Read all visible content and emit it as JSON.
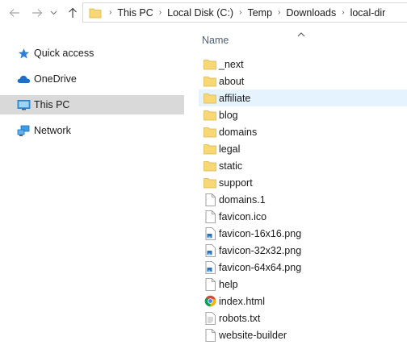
{
  "breadcrumb": {
    "items": [
      "This PC",
      "Local Disk (C:)",
      "Temp",
      "Downloads",
      "local-dir"
    ]
  },
  "navpane": {
    "items": [
      {
        "label": "Quick access",
        "icon": "star-icon"
      },
      {
        "label": "OneDrive",
        "icon": "cloud-icon"
      },
      {
        "label": "This PC",
        "icon": "computer-icon",
        "selected": true
      },
      {
        "label": "Network",
        "icon": "network-icon"
      }
    ]
  },
  "list": {
    "column_name": "Name",
    "items": [
      {
        "name": "_next",
        "type": "folder"
      },
      {
        "name": "about",
        "type": "folder"
      },
      {
        "name": "affiliate",
        "type": "folder",
        "hover": true
      },
      {
        "name": "blog",
        "type": "folder"
      },
      {
        "name": "domains",
        "type": "folder"
      },
      {
        "name": "legal",
        "type": "folder"
      },
      {
        "name": "static",
        "type": "folder"
      },
      {
        "name": "support",
        "type": "folder"
      },
      {
        "name": "domains.1",
        "type": "file"
      },
      {
        "name": "favicon.ico",
        "type": "file"
      },
      {
        "name": "favicon-16x16.png",
        "type": "image"
      },
      {
        "name": "favicon-32x32.png",
        "type": "image"
      },
      {
        "name": "favicon-64x64.png",
        "type": "image"
      },
      {
        "name": "help",
        "type": "file"
      },
      {
        "name": "index.html",
        "type": "chrome"
      },
      {
        "name": "robots.txt",
        "type": "text"
      },
      {
        "name": "website-builder",
        "type": "file"
      }
    ]
  },
  "colors": {
    "selected_bg": "#d9d9d9",
    "hover_bg": "#e5f3ff",
    "folder": "#f8d775",
    "header_text": "#4c607a"
  }
}
